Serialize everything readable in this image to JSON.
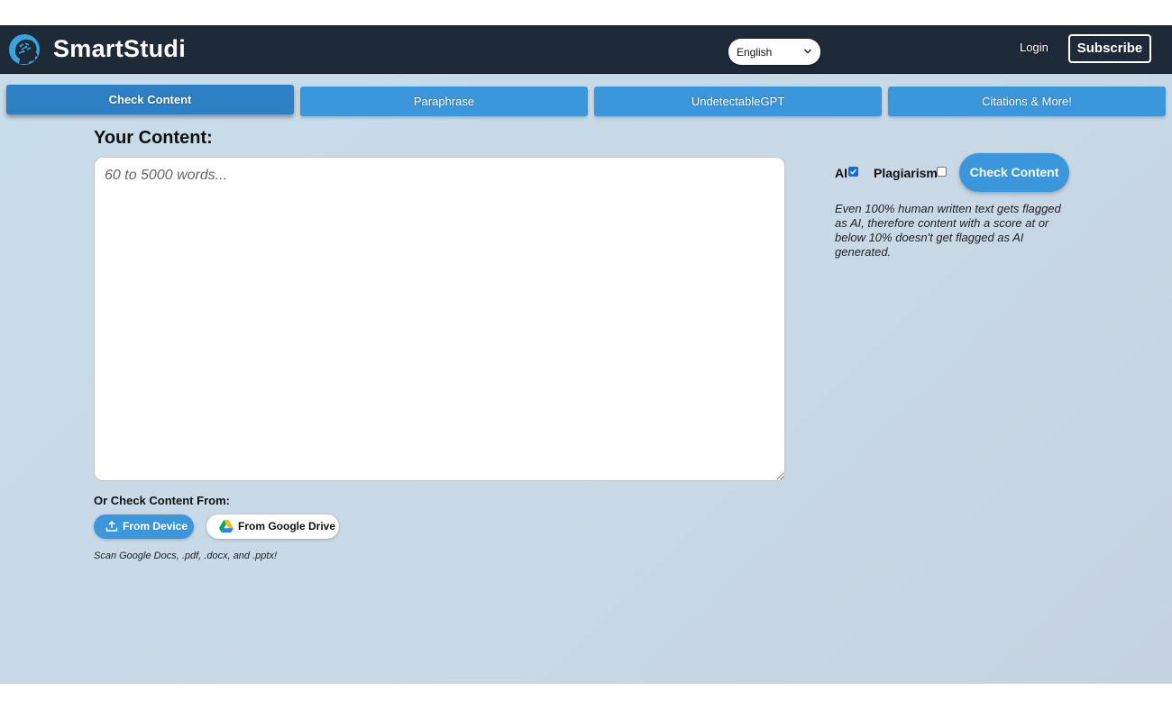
{
  "header": {
    "brand": "SmartStudi",
    "language": "English",
    "login_label": "Login",
    "subscribe_label": "Subscribe"
  },
  "tabs": [
    {
      "label": "Check Content",
      "active": true
    },
    {
      "label": "Paraphrase",
      "active": false
    },
    {
      "label": "UndetectableGPT",
      "active": false
    },
    {
      "label": "Citations & More!",
      "active": false
    }
  ],
  "content": {
    "title": "Your Content:",
    "placeholder": "60 to 5000 words...",
    "or_check_label": "Or Check Content From:",
    "from_device_label": "From Device",
    "from_drive_label": "From Google Drive",
    "scan_note": "Scan Google Docs, .pdf, .docx, and .pptx!"
  },
  "options": {
    "ai_label": "AI",
    "ai_checked": true,
    "plagiarism_label": "Plagiarism",
    "plagiarism_checked": false,
    "check_button_label": "Check Content",
    "disclaimer": "Even 100% human written text gets flagged as AI, therefore content with a score at or below 10% doesn't get flagged as AI generated."
  },
  "colors": {
    "header_bg": "#1f2a39",
    "accent": "#3b97dc",
    "accent_active": "#2c80c3"
  },
  "icons": {
    "logo": "brain-head-logo-icon",
    "language_dropdown": "chevron-down-icon",
    "device": "upload-icon",
    "drive": "google-drive-icon"
  }
}
